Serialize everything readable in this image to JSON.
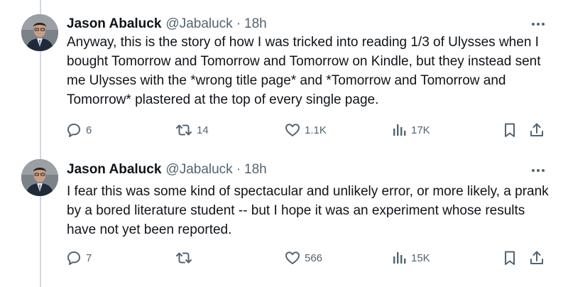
{
  "tweets": [
    {
      "author": {
        "name": "Jason Abaluck",
        "handle": "@Jabaluck",
        "separator": "·",
        "time": "18h"
      },
      "text": "Anyway, this is the story of how I was tricked into reading 1/3 of Ulysses when I bought Tomorrow and Tomorrow and Tomorrow on Kindle, but they instead sent me Ulysses with the *wrong title page* and *Tomorrow and Tomorrow and Tomorrow* plastered at the top of every single page.",
      "replies": "6",
      "reposts": "14",
      "likes": "1.1K",
      "views": "17K"
    },
    {
      "author": {
        "name": "Jason Abaluck",
        "handle": "@Jabaluck",
        "separator": "·",
        "time": "18h"
      },
      "text": "I fear this was some kind of spectacular and unlikely error, or more likely, a prank by a bored literature student -- but I hope it was an experiment whose results have not yet been reported.",
      "replies": "7",
      "reposts": "",
      "likes": "566",
      "views": "15K"
    }
  ],
  "icons": {
    "more": "more-icon",
    "reply": "reply-icon",
    "repost": "repost-icon",
    "like": "heart-icon",
    "views": "views-icon",
    "bookmark": "bookmark-icon",
    "share": "share-icon"
  },
  "colors": {
    "text": "#0f1419",
    "secondary": "#536471",
    "thread_line": "#cfd9de"
  }
}
